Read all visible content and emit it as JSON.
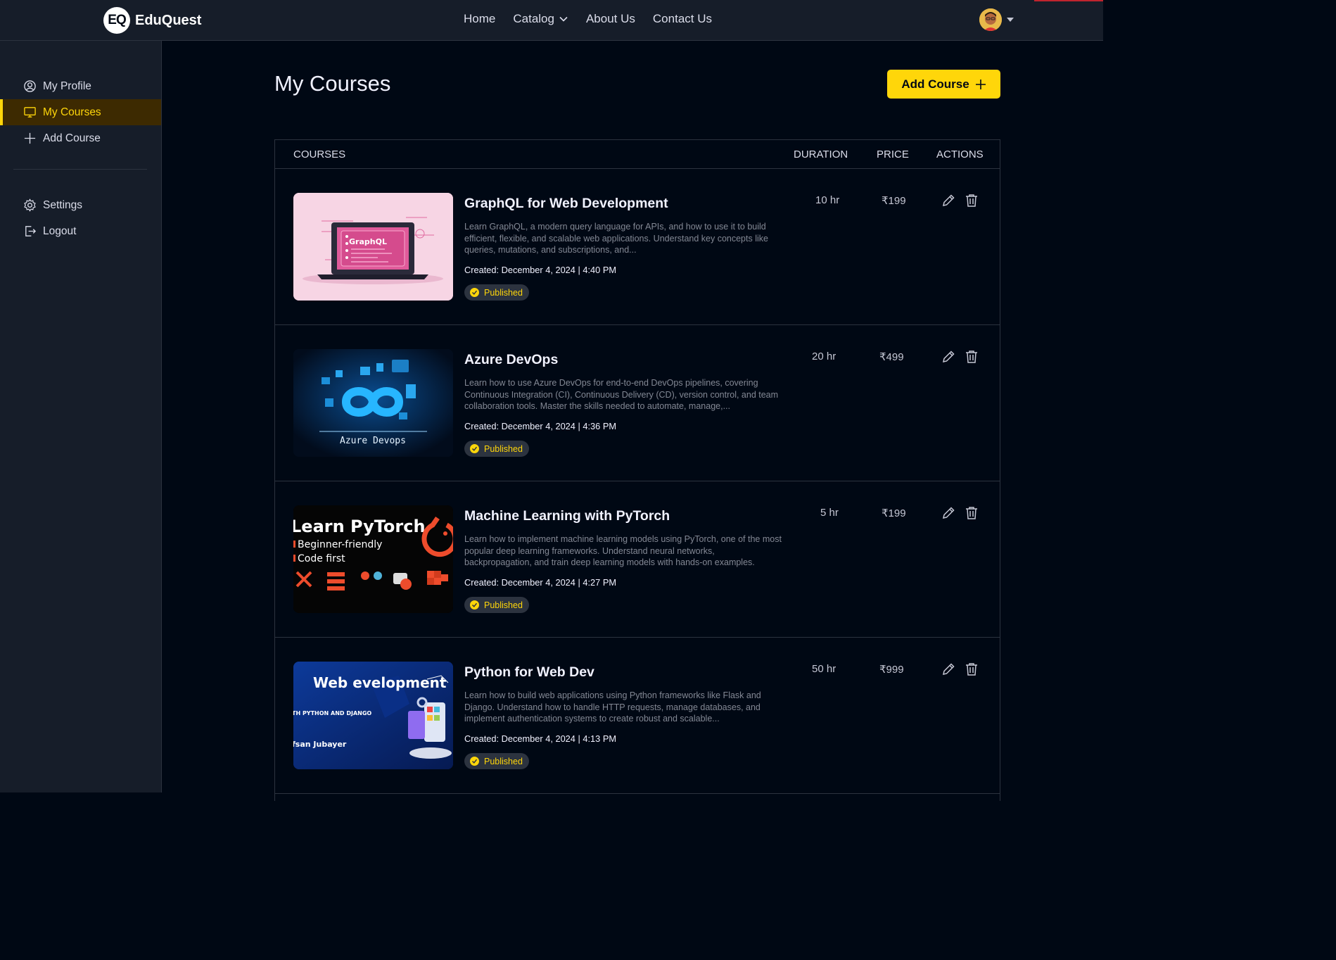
{
  "brand": {
    "badge": "EQ",
    "name": "EduQuest"
  },
  "nav": {
    "items": [
      "Home",
      "Catalog",
      "About Us",
      "Contact Us"
    ]
  },
  "sidebar": {
    "items": [
      {
        "label": "My Profile",
        "icon": "user-circle-icon"
      },
      {
        "label": "My Courses",
        "icon": "monitor-icon"
      },
      {
        "label": "Add Course",
        "icon": "plus-icon"
      }
    ],
    "bottom": [
      {
        "label": "Settings",
        "icon": "gear-icon"
      },
      {
        "label": "Logout",
        "icon": "logout-icon"
      }
    ]
  },
  "page": {
    "title": "My Courses",
    "add_button": "Add Course"
  },
  "table": {
    "headers": [
      "Courses",
      "Duration",
      "Price",
      "Actions"
    ],
    "rows": [
      {
        "title": "GraphQL for Web Development",
        "description": "Learn GraphQL, a modern query language for APIs, and how to use it to build efficient, flexible, and scalable web applications. Understand key concepts like queries, mutations, and subscriptions, and...",
        "created": "Created: December 4, 2024 | 4:40 PM",
        "status": "Published",
        "duration": "10 hr",
        "price": "₹199",
        "thumb_text": "GraphQL"
      },
      {
        "title": "Azure DevOps",
        "description": "Learn how to use Azure DevOps for end-to-end DevOps pipelines, covering Continuous Integration (CI), Continuous Delivery (CD), version control, and team collaboration tools. Master the skills needed to automate, manage,...",
        "created": "Created: December 4, 2024 | 4:36 PM",
        "status": "Published",
        "duration": "20 hr",
        "price": "₹499",
        "thumb_text": "Azure Devops"
      },
      {
        "title": "Machine Learning with PyTorch",
        "description": "Learn how to implement machine learning models using PyTorch, one of the most popular deep learning frameworks. Understand neural networks, backpropagation, and train deep learning models with hands-on examples.",
        "created": "Created: December 4, 2024 | 4:27 PM",
        "status": "Published",
        "duration": "5 hr",
        "price": "₹199",
        "thumb_text": "Learn PyTorch",
        "thumb_lines": [
          "Beginner-friendly",
          "Code first"
        ]
      },
      {
        "title": "Python for Web Dev",
        "description": "Learn how to build web applications using Python frameworks like Flask and Django. Understand how to handle HTTP requests, manage databases, and implement authentication systems to create robust and scalable...",
        "created": "Created: December 4, 2024 | 4:13 PM",
        "status": "Published",
        "duration": "50 hr",
        "price": "₹999",
        "thumb_text": "Web evelopment",
        "thumb_lines": [
          "TH PYTHON AND DJANGO",
          "fsan Jubayer"
        ]
      }
    ]
  },
  "colors": {
    "accent": "#ffd60a",
    "bg": "#000814",
    "panel": "#161d29",
    "border": "#2c333f"
  }
}
